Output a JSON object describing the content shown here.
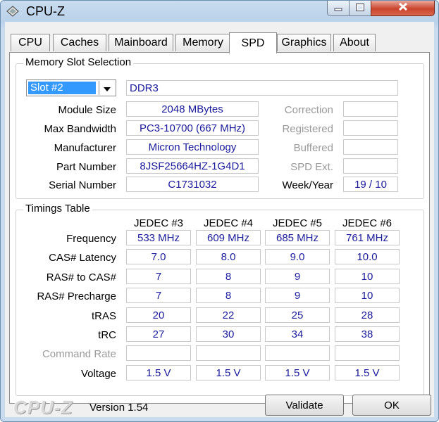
{
  "window": {
    "title": "CPU-Z"
  },
  "tabs": [
    {
      "label": "CPU"
    },
    {
      "label": "Caches"
    },
    {
      "label": "Mainboard"
    },
    {
      "label": "Memory"
    },
    {
      "label": "SPD"
    },
    {
      "label": "Graphics"
    },
    {
      "label": "About"
    }
  ],
  "slot": {
    "legend": "Memory Slot Selection",
    "selected": "Slot #2",
    "type": "DDR3",
    "labels": {
      "module_size": "Module Size",
      "max_bandwidth": "Max Bandwidth",
      "manufacturer": "Manufacturer",
      "part_number": "Part Number",
      "serial_number": "Serial Number",
      "correction": "Correction",
      "registered": "Registered",
      "buffered": "Buffered",
      "spd_ext": "SPD Ext.",
      "week_year": "Week/Year"
    },
    "values": {
      "module_size": "2048 MBytes",
      "max_bandwidth": "PC3-10700 (667 MHz)",
      "manufacturer": "Micron Technology",
      "part_number": "8JSF25664HZ-1G4D1",
      "serial_number": "C1731032",
      "correction": "",
      "registered": "",
      "buffered": "",
      "spd_ext": "",
      "week_year": "19 / 10"
    }
  },
  "timings": {
    "legend": "Timings Table",
    "columns": [
      "JEDEC #3",
      "JEDEC #4",
      "JEDEC #5",
      "JEDEC #6"
    ],
    "rows": [
      {
        "label": "Frequency",
        "disabled": false,
        "cells": [
          "533 MHz",
          "609 MHz",
          "685 MHz",
          "761 MHz"
        ]
      },
      {
        "label": "CAS# Latency",
        "disabled": false,
        "cells": [
          "7.0",
          "8.0",
          "9.0",
          "10.0"
        ]
      },
      {
        "label": "RAS# to CAS#",
        "disabled": false,
        "cells": [
          "7",
          "8",
          "9",
          "10"
        ]
      },
      {
        "label": "RAS# Precharge",
        "disabled": false,
        "cells": [
          "7",
          "8",
          "9",
          "10"
        ]
      },
      {
        "label": "tRAS",
        "disabled": false,
        "cells": [
          "20",
          "22",
          "25",
          "28"
        ]
      },
      {
        "label": "tRC",
        "disabled": false,
        "cells": [
          "27",
          "30",
          "34",
          "38"
        ]
      },
      {
        "label": "Command Rate",
        "disabled": true,
        "cells": [
          "",
          "",
          "",
          ""
        ]
      },
      {
        "label": "Voltage",
        "disabled": false,
        "cells": [
          "1.5 V",
          "1.5 V",
          "1.5 V",
          "1.5 V"
        ]
      }
    ]
  },
  "footer": {
    "brand": "CPU-Z",
    "version": "Version 1.54",
    "validate_label": "Validate",
    "ok_label": "OK"
  },
  "colors": {
    "value_text": "#1a1a9c",
    "selection": "#3399ff",
    "close_button": "#c9452d"
  }
}
